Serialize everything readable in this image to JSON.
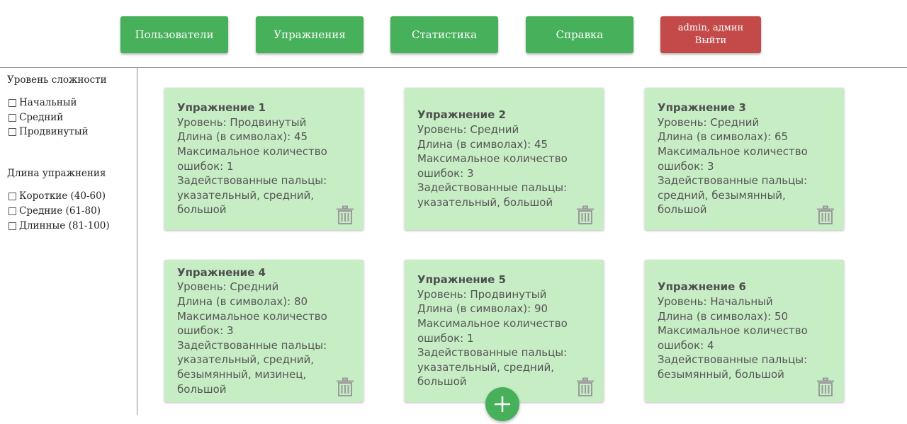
{
  "nav": {
    "users": "Пользователи",
    "exercises": "Упражнения",
    "stats": "Статистика",
    "help": "Справка",
    "user_line": "admin, админ",
    "logout": "Выйти"
  },
  "filters": {
    "level_title": "Уровень сложности",
    "levels": [
      "Начальный",
      "Средний",
      "Продвинутый"
    ],
    "length_title": "Длина упражнения",
    "lengths": [
      "Короткие (40-60)",
      "Средние (61-80)",
      "Длинные (81-100)"
    ]
  },
  "exercises": [
    {
      "title": "Упражнение 1",
      "lines": [
        "Уровень: Продвинутый",
        "Длина (в символах): 45",
        "Максимальное количество",
        "ошибок: 1",
        "Задействованные пальцы:",
        "указательный, средний,",
        "большой"
      ]
    },
    {
      "title": "Упражнение 2",
      "lines": [
        "Уровень: Средний",
        "Длина (в символах): 45",
        "Максимальное количество",
        "ошибок: 3",
        "Задействованные пальцы:",
        "указательный, большой"
      ]
    },
    {
      "title": "Упражнение 3",
      "lines": [
        "Уровень: Средний",
        "Длина (в символах): 65",
        "Максимальное количество",
        "ошибок: 3",
        "Задействованные пальцы:",
        "средний, безымянный,",
        "большой"
      ]
    },
    {
      "title": "Упражнение 4",
      "lines": [
        "Уровень: Средний",
        "Длина (в символах): 80",
        "Максимальное количество",
        "ошибок: 3",
        "Задействованные пальцы:",
        "указательный, средний,",
        "безымянный, мизинец,",
        "большой"
      ]
    },
    {
      "title": "Упражнение 5",
      "lines": [
        "Уровень: Продвинутый",
        "Длина (в символах): 90",
        "Максимальное количество",
        "ошибок: 1",
        "Задействованные пальцы:",
        "указательный, средний,",
        "большой"
      ]
    },
    {
      "title": "Упражнение 6",
      "lines": [
        "Уровень: Начальный",
        "Длина (в символах): 50",
        "Максимальное количество",
        "ошибок: 4",
        "Задействованные пальцы:",
        "безымянный, большой"
      ]
    }
  ],
  "icons": {
    "delete": "trash-icon",
    "add": "plus-icon"
  },
  "colors": {
    "nav_green": "#46b05a",
    "logout_red": "#c44a4a",
    "card_bg": "#c7edc5"
  }
}
